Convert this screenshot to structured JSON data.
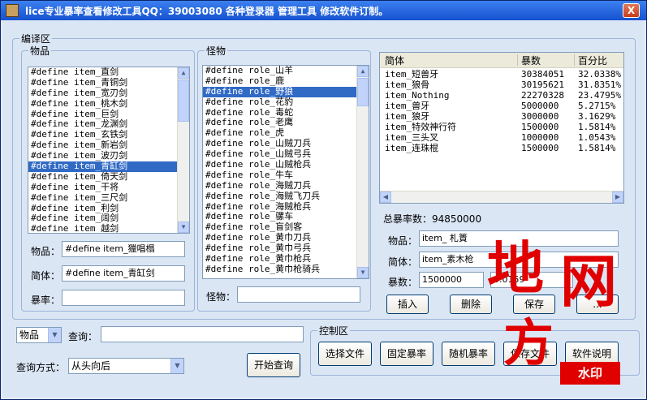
{
  "window": {
    "title": "lice专业暴率查看修改工具QQ：39003080   各种登录器 管理工具 修改软件订制。",
    "close_label": "X"
  },
  "compile_area": {
    "legend": "编译区",
    "items_group": {
      "legend": "物品",
      "items": [
        "#define item_直剑",
        "#define item_青铜剑",
        "#define item_宽刃剑",
        "#define item_桃木剑",
        "#define item_巨剑",
        "#define item_龙渊剑",
        "#define item_玄铁剑",
        "#define item_新岩剑",
        "#define item_波刃剑",
        "#define item_青缸剑",
        "#define item_倚天剑",
        "#define item_干将",
        "#define item_三尺剑",
        "#define item_利剑",
        "#define item_阔剑",
        "#define item_越剑"
      ],
      "selected_index": 9,
      "item_field_label": "物品：",
      "item_field_value": "#define item_獵唱榻",
      "simplified_label": "简体：",
      "simplified_value": "#define item_青缸剑",
      "rate_label": "暴率：",
      "rate_value": ""
    },
    "monsters_group": {
      "legend": "怪物",
      "items": [
        "#define role_山羊",
        "#define role_鹿",
        "#define role_野狼",
        "#define role_花豹",
        "#define role_毒蛇",
        "#define role_老鹰",
        "#define role_虎",
        "#define role_山贼刀兵",
        "#define role_山贼弓兵",
        "#define role_山贼枪兵",
        "#define role_牛车",
        "#define role_海贼刀兵",
        "#define role_海贼飞刀兵",
        "#define role_海贼枪兵",
        "#define role_骡车",
        "#define role_盲剑客",
        "#define role_黄巾刀兵",
        "#define role_黄巾弓兵",
        "#define role_黄巾枪兵",
        "#define role_黄巾枪骑兵"
      ],
      "selected_index": 2,
      "monster_field_label": "怪物：",
      "monster_field_value": ""
    },
    "drop_table": {
      "headers": [
        "简体",
        "暴数",
        "百分比"
      ],
      "rows": [
        [
          "item_短兽牙",
          "30384051",
          "32.0338%"
        ],
        [
          "item_狼骨",
          "30195621",
          "31.8351%"
        ],
        [
          "item_Nothing",
          "22270328",
          "23.4795%"
        ],
        [
          "item_兽牙",
          "5000000",
          "5.2715%"
        ],
        [
          "item_狼牙",
          "3000000",
          "3.1629%"
        ],
        [
          "item_特效神行符",
          "1500000",
          "1.5814%"
        ],
        [
          "item_三头叉",
          "1000000",
          "1.0543%"
        ],
        [
          "item_连珠棍",
          "1500000",
          "1.5814%"
        ]
      ],
      "total_label": "总暴率数：94850000",
      "item_label": "物品：",
      "item_value": "item_    札篢",
      "simplified_label": "简体：",
      "simplified_value": "item_素木枪",
      "count_label": "暴数：",
      "count_value": "1500000",
      "percent_value": "0.0159",
      "insert_label": "插入",
      "delete_label": "删除",
      "save_label": "保存",
      "extra_label": "..."
    }
  },
  "query": {
    "type_value": "物品",
    "query_label": "查询：",
    "query_value": "",
    "mode_label": "查询方式：",
    "mode_value": "从头向后",
    "start_label": "开始查询"
  },
  "control_area": {
    "legend": "控制区",
    "buttons": [
      "选择文件",
      "固定暴率",
      "随机暴率",
      "保存文件",
      "软件说明"
    ]
  },
  "watermark": {
    "chars": [
      "地",
      "网",
      "方"
    ],
    "badge": "水印"
  },
  "colors": {
    "titlebar": "#1652d0",
    "selection": "#316ac5",
    "watermark": "#e00000"
  }
}
